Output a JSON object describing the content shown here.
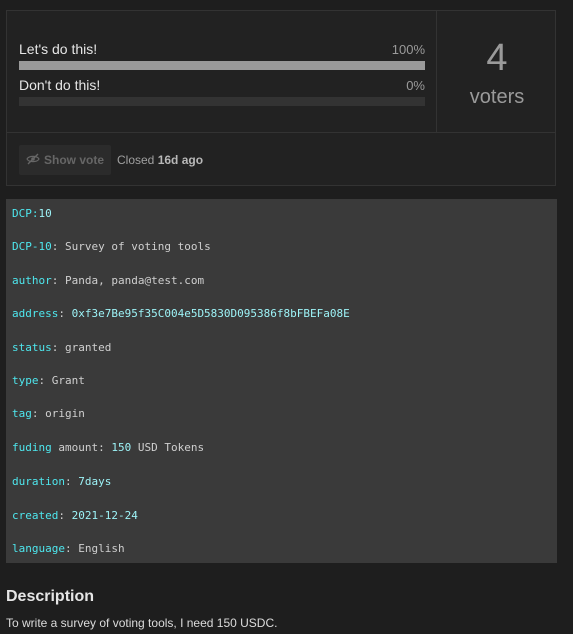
{
  "poll": {
    "options": [
      {
        "label": "Let's do this!",
        "percent_text": "100%",
        "percent": 100
      },
      {
        "label": "Don't do this!",
        "percent_text": "0%",
        "percent": 0
      }
    ],
    "voters_count": "4",
    "voters_label": "voters",
    "show_vote_label": "Show vote",
    "show_vote_icon": "eye-slash-icon",
    "closed_prefix": "Closed",
    "closed_time": "16d ago"
  },
  "meta": {
    "dcp_key": "DCP",
    "dcp_value": "10",
    "title_key": "DCP-10",
    "title_value": "Survey of voting tools",
    "author_key": "author",
    "author_value": "Panda, panda@test.com",
    "address_key": "address",
    "address_value": "0xf3e7Be95f35C004e5D5830D095386f8bFBEFa08E",
    "status_key": "status",
    "status_value": "granted",
    "type_key": "type",
    "type_value": "Grant",
    "tag_key": "tag",
    "tag_value": "origin",
    "funding_key": "fuding",
    "funding_mid": "amount",
    "funding_number": "150",
    "funding_unit": "USD Tokens",
    "duration_key": "duration",
    "duration_value": "7days",
    "created_key": "created",
    "created_value": "2021-12-24",
    "language_key": "language",
    "language_value": "English"
  },
  "description": {
    "heading": "Description",
    "text": "To write a survey of voting tools, I need 150 USDC."
  },
  "colors": {
    "key": "#4ee7ee",
    "bar_fill": "#9a9a9a",
    "bar_track": "#333333",
    "meta_bg": "#3a3a3a"
  }
}
